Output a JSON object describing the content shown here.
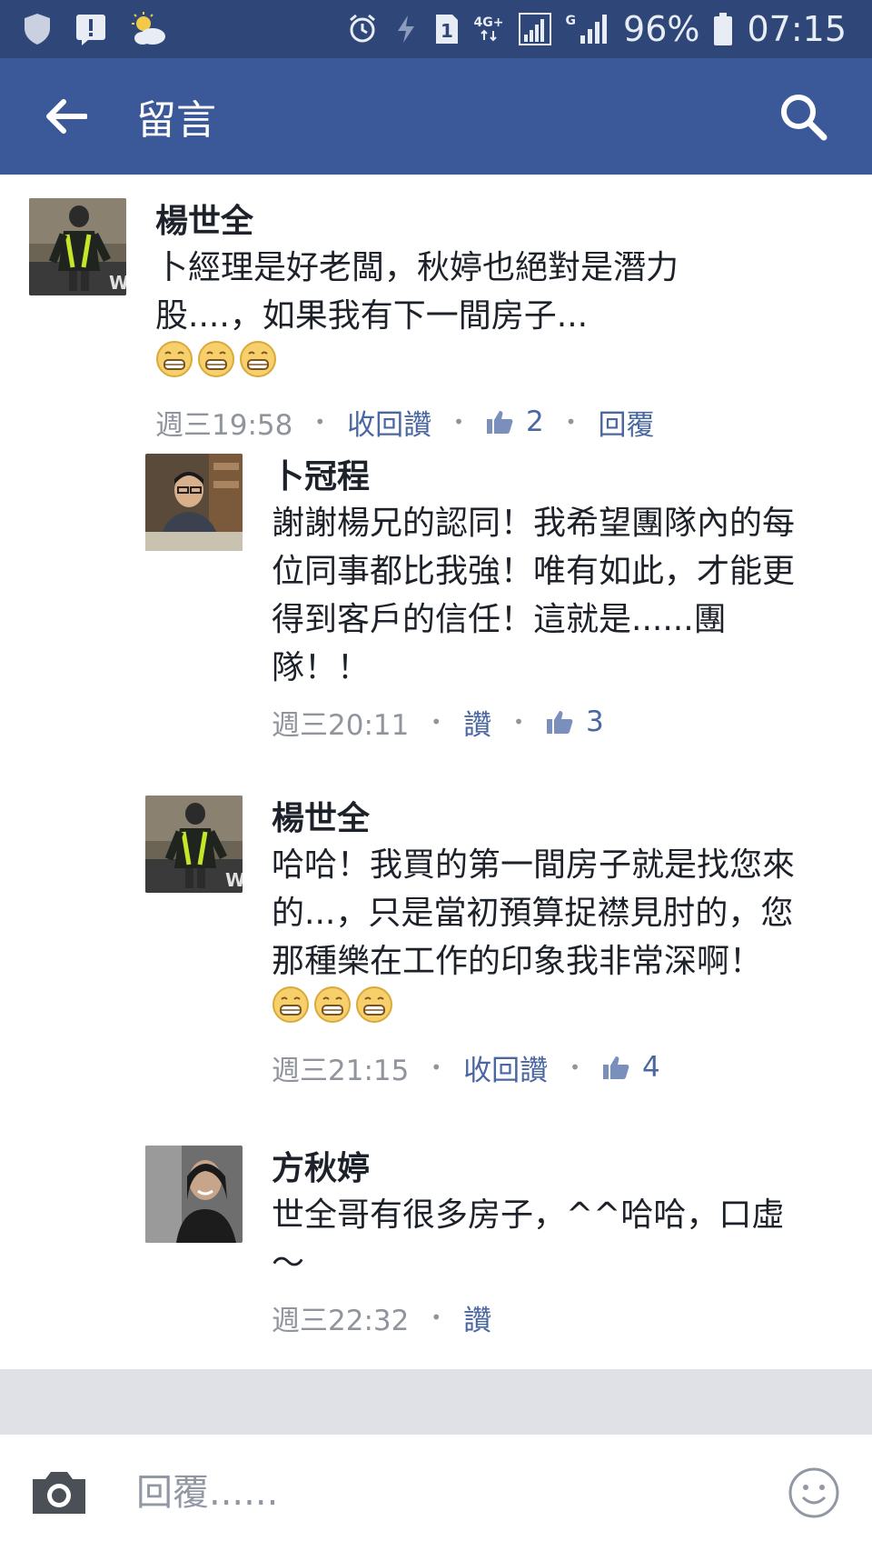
{
  "status_bar": {
    "battery_percent": "96%",
    "time": "07:15",
    "sim_slot": "1",
    "network_label": "4G+",
    "network_label_2": "G"
  },
  "app_bar": {
    "title": "留言"
  },
  "comments": [
    {
      "author": "楊世全",
      "text": "卜經理是好老闆，秋婷也絕對是潛力股....，如果我有下一間房子...",
      "emoji_count": 3,
      "time": "週三19:58",
      "like_action": "收回讚",
      "likes": "2",
      "reply_action": "回覆"
    },
    {
      "author": "卜冠程",
      "text": "謝謝楊兄的認同！我希望團隊內的每位同事都比我強！唯有如此，才能更得到客戶的信任！這就是......團隊！！",
      "time": "週三20:11",
      "like_action": "讚",
      "likes": "3"
    },
    {
      "author": "楊世全",
      "text": "哈哈！我買的第一間房子就是找您來的...，只是當初預算捉襟見肘的，您那種樂在工作的印象我非常深啊！",
      "emoji_count": 3,
      "time": "週三21:15",
      "like_action": "收回讚",
      "likes": "4"
    },
    {
      "author": "方秋婷",
      "text": "世全哥有很多房子，^^哈哈，口虛～",
      "time": "週三22:32",
      "like_action": "讚"
    }
  ],
  "composer": {
    "placeholder": "回覆......"
  },
  "colors": {
    "status_bar": "#2f4679",
    "app_bar": "#3b5998",
    "link": "#4b67a1",
    "meta_gray": "#90949c"
  }
}
